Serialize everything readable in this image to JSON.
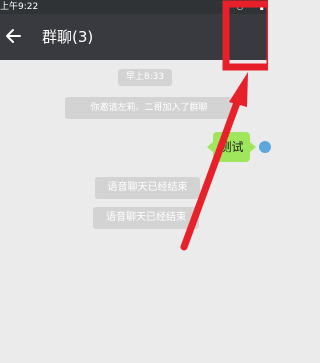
{
  "status_bar": {
    "time": "上午9:22"
  },
  "header": {
    "title": "群聊(3)",
    "back_icon": "back-arrow-icon",
    "menu_icon": "group-info-icon"
  },
  "messages": {
    "timestamp": "早上8:33",
    "invite_notice": "你邀请左莉、二哥加入了群聊",
    "my_message": "测试",
    "voice_ended_1": "语音聊天已经结束",
    "voice_ended_2": "语音聊天已经结束"
  },
  "annotation": {
    "highlight_color": "#e8202a"
  }
}
